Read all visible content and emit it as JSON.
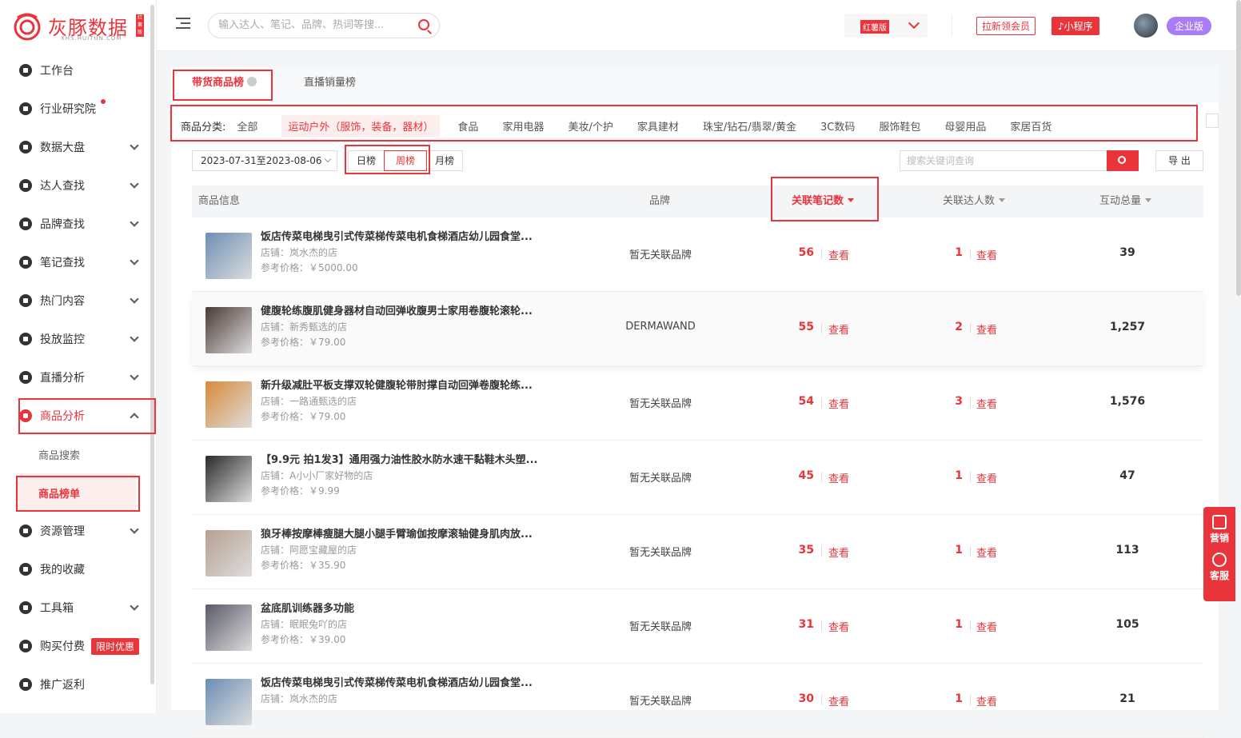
{
  "brand": {
    "name": "灰豚数据",
    "sub": "XHS.HUITUN.COM",
    "badge": "红薯版"
  },
  "sidebar": {
    "items": [
      {
        "label": "工作台",
        "icon": "home-icon"
      },
      {
        "label": "行业研究院",
        "icon": "research-icon",
        "dot": true
      },
      {
        "label": "数据大盘",
        "icon": "chart-icon",
        "expand": true
      },
      {
        "label": "达人查找",
        "icon": "search-user-icon",
        "expand": true
      },
      {
        "label": "品牌查找",
        "icon": "brand-icon",
        "expand": true
      },
      {
        "label": "笔记查找",
        "icon": "note-icon",
        "expand": true
      },
      {
        "label": "热门内容",
        "icon": "fire-icon",
        "expand": true
      },
      {
        "label": "投放监控",
        "icon": "monitor-icon",
        "expand": true
      },
      {
        "label": "直播分析",
        "icon": "live-icon",
        "expand": true
      },
      {
        "label": "商品分析",
        "icon": "goods-icon",
        "expand": true,
        "open": true
      },
      {
        "label": "资源管理",
        "icon": "resource-icon",
        "expand": true
      },
      {
        "label": "我的收藏",
        "icon": "star-icon"
      },
      {
        "label": "工具箱",
        "icon": "toolbox-icon",
        "expand": true
      },
      {
        "label": "购买付费",
        "icon": "pay-icon",
        "promo": "限时优惠"
      },
      {
        "label": "推广返利",
        "icon": "rebate-icon"
      }
    ],
    "sub_items": [
      "商品搜索",
      "商品榜单"
    ]
  },
  "header": {
    "search_placeholder": "输入达人、笔记、品牌、热词等搜...",
    "version_tag": "红薯版",
    "invite_btn": "拉新领会员",
    "mini_btn": "小程序",
    "enterprise_btn": "企业版"
  },
  "tabs": [
    "带货商品榜",
    "直播销量榜"
  ],
  "categories": {
    "label": "商品分类:",
    "items": [
      "全部",
      "运动户外（服饰，装备，器材）",
      "食品",
      "家用电器",
      "美妆/个护",
      "家具建材",
      "珠宝/钻石/翡翠/黄金",
      "3C数码",
      "服饰鞋包",
      "母婴用品",
      "家居百货"
    ],
    "selected": 1
  },
  "filters": {
    "date_range": "2023-07-31至2023-08-06",
    "periods": [
      "日榜",
      "周榜",
      "月榜"
    ],
    "selected_period": 1,
    "keyword_placeholder": "搜索关键词查询",
    "export": "导 出"
  },
  "table": {
    "headers": [
      "商品信息",
      "品牌",
      "关联笔记数",
      "关联达人数",
      "互动总量"
    ],
    "view_label": "查看",
    "shop_prefix": "店铺：",
    "price_prefix": "参考价格：",
    "rows": [
      {
        "name": "饭店传菜电梯曳引式传菜梯传菜电机食梯酒店幼儿园食堂...",
        "shop": "店铺：岚水杰的店",
        "price": "参考价格：￥5000.00",
        "brand": "暂无关联品牌",
        "notes": "56",
        "kols": "1",
        "total": "39",
        "thumb": "#6b8fb5"
      },
      {
        "name": "健腹轮练腹肌健身器材自动回弹收腹男士家用卷腹轮滚轮...",
        "shop": "店铺：新秀甄选的店",
        "price": "参考价格：￥79.00",
        "brand": "DERMAWAND",
        "notes": "55",
        "kols": "2",
        "total": "1,257",
        "thumb": "#4a3a35"
      },
      {
        "name": "新升级减肚平板支撑双轮健腹轮带肘撑自动回弹卷腹轮练...",
        "shop": "店铺：一路通甄选的店",
        "price": "参考价格：￥79.00",
        "brand": "暂无关联品牌",
        "notes": "54",
        "kols": "3",
        "total": "1,576",
        "thumb": "#d98a3a"
      },
      {
        "name": "【9.9元 拍1发3】通用强力油性胶水防水速干黏鞋木头塑...",
        "shop": "店铺：A小小厂家好物的店",
        "price": "参考价格：￥9.99",
        "brand": "暂无关联品牌",
        "notes": "45",
        "kols": "1",
        "total": "47",
        "thumb": "#2a2a2a"
      },
      {
        "name": "狼牙棒按摩棒瘦腿大腿小腿手臂瑜伽按摩滚轴健身肌肉放...",
        "shop": "店铺：阿愿宝藏屋的店",
        "price": "参考价格：￥35.90",
        "brand": "暂无关联品牌",
        "notes": "35",
        "kols": "1",
        "total": "113",
        "thumb": "#b8a090"
      },
      {
        "name": "盆底肌训练器多功能",
        "shop": "店铺：眠眠兔吖的店",
        "price": "参考价格：￥39.00",
        "brand": "暂无关联品牌",
        "notes": "31",
        "kols": "1",
        "total": "105",
        "thumb": "#5a5a6a"
      },
      {
        "name": "饭店传菜电梯曳引式传菜梯传菜电机食梯酒店幼儿园食堂...",
        "shop": "店铺：岚水杰的店",
        "price": "",
        "brand": "暂无关联品牌",
        "notes": "30",
        "kols": "1",
        "total": "21",
        "thumb": "#6b8fb5"
      }
    ]
  },
  "float": {
    "marketing": "营销",
    "service": "客服"
  }
}
